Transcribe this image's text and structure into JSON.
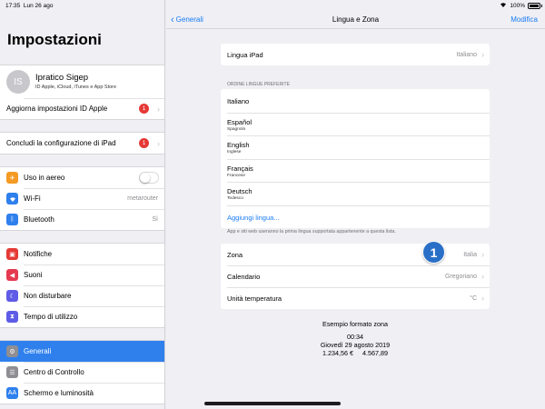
{
  "status_bar": {
    "time": "17:35",
    "date": "Lun 26 ago",
    "battery": "100%",
    "battery_level": 1.0
  },
  "sidebar": {
    "title": "Impostazioni",
    "profile": {
      "initials": "IS",
      "name": "Ipratico Sigep",
      "subtitle": "ID Apple, iCloud, iTunes e App Store"
    },
    "apple_id_update": {
      "label": "Aggiorna impostazioni ID Apple",
      "badge": "1"
    },
    "finish_setup": {
      "label": "Concludi la configurazione di iPad",
      "badge": "1"
    },
    "connectivity": [
      {
        "id": "airplane",
        "label": "Uso in aereo",
        "icon": "airplane-icon",
        "color": "#f59a23",
        "toggle": false
      },
      {
        "id": "wifi",
        "label": "Wi-Fi",
        "value": "metarouter",
        "icon": "wifi-icon",
        "color": "#2f80ed"
      },
      {
        "id": "bluetooth",
        "label": "Bluetooth",
        "value": "Sì",
        "icon": "bluetooth-icon",
        "color": "#2f80ed"
      }
    ],
    "notifications_group": [
      {
        "id": "notifications",
        "label": "Notifiche",
        "icon": "notifications-icon",
        "color": "#e53935"
      },
      {
        "id": "sounds",
        "label": "Suoni",
        "icon": "speaker-icon",
        "color": "#e53950"
      },
      {
        "id": "dnd",
        "label": "Non disturbare",
        "icon": "moon-icon",
        "color": "#5e5ce6"
      },
      {
        "id": "screen-time",
        "label": "Tempo di utilizzo",
        "icon": "hourglass-icon",
        "color": "#5e5ce6"
      }
    ],
    "general_group": [
      {
        "id": "general",
        "label": "Generali",
        "icon": "gear-icon",
        "color": "#8e8e93",
        "selected": true
      },
      {
        "id": "control-center",
        "label": "Centro di Controllo",
        "icon": "switches-icon",
        "color": "#8e8e93"
      },
      {
        "id": "display",
        "label": "Schermo e luminosità",
        "icon": "display-icon",
        "color": "#2f80ed"
      }
    ]
  },
  "nav": {
    "back": "Generali",
    "title": "Lingua e Zona",
    "edit": "Modifica"
  },
  "ipad_language": {
    "label": "Lingua iPad",
    "value": "Italiano"
  },
  "preferred": {
    "header": "ORDINE LINGUE PREFERITE",
    "languages": [
      {
        "name": "Italiano",
        "sub": ""
      },
      {
        "name": "Español",
        "sub": "Spagnolo"
      },
      {
        "name": "English",
        "sub": "Inglese"
      },
      {
        "name": "Français",
        "sub": "Francese"
      },
      {
        "name": "Deutsch",
        "sub": "Tedesco"
      }
    ],
    "add": "Aggiungi lingua...",
    "footnote": "App e siti web useranno la prima lingua supportata appartenente a questa lista."
  },
  "region": [
    {
      "id": "zona",
      "label": "Zona",
      "value": "Italia"
    },
    {
      "id": "calendario",
      "label": "Calendario",
      "value": "Gregoriano"
    },
    {
      "id": "unita",
      "label": "Unità temperatura",
      "value": "°C"
    }
  ],
  "format_example": {
    "title": "Esempio formato zona",
    "time": "00:34",
    "date": "Giovedì 29 agosto 2019",
    "currency": "1.234,56 €",
    "number": "4.567,89"
  },
  "callout": "1"
}
